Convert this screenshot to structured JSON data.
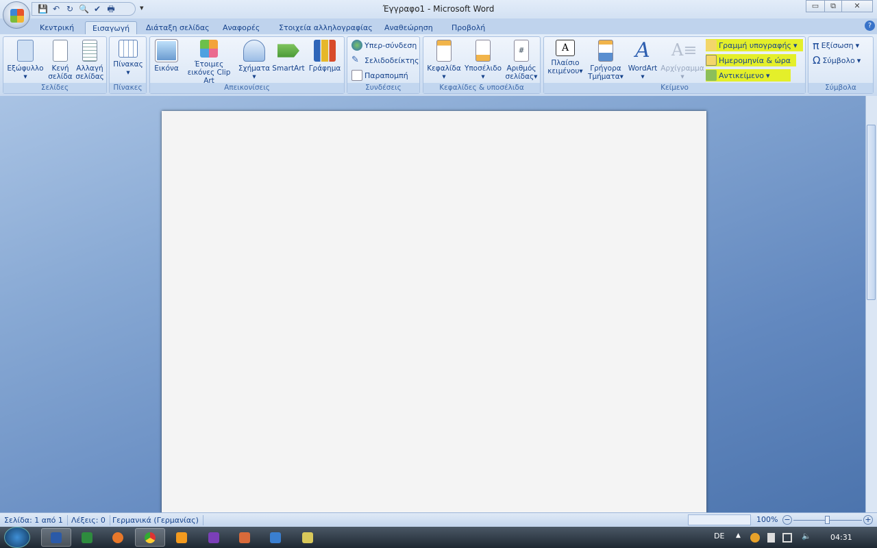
{
  "window": {
    "title": "Έγγραφο1 - Microsoft Word",
    "minimize": "▭",
    "restore": "⧉",
    "close": "✕"
  },
  "qat": {
    "icons": [
      "save-icon",
      "undo-icon",
      "redo-icon",
      "print-preview-icon",
      "spelling-icon",
      "quick-print-icon"
    ],
    "customize": "▾"
  },
  "tabs": [
    "Κεντρική",
    "Εισαγωγή",
    "Διάταξη σελίδας",
    "Αναφορές",
    "Στοιχεία αλληλογραφίας",
    "Αναθεώρηση",
    "Προβολή"
  ],
  "active_tab": "Εισαγωγή",
  "help": "?",
  "highlight_color": "#e4ef2a",
  "ribbon": {
    "pages": {
      "label": "Σελίδες",
      "cover": "Εξώφυλλο",
      "blank_1": "Κενή",
      "blank_2": "σελίδα",
      "break_1": "Αλλαγή",
      "break_2": "σελίδας"
    },
    "tables": {
      "label": "Πίνακες",
      "table": "Πίνακας"
    },
    "illustrations": {
      "label": "Απεικονίσεις",
      "picture": "Εικόνα",
      "clipart_1": "Έτοιμες",
      "clipart_2": "εικόνες Clip Art",
      "shapes": "Σχήματα",
      "smartart": "SmartArt",
      "chart": "Γράφημα"
    },
    "links": {
      "label": "Συνδέσεις",
      "hyperlink": "Υπερ-σύνδεση",
      "bookmark": "Σελιδοδείκτης",
      "crossref": "Παραπομπή"
    },
    "headerfooter": {
      "label": "Κεφαλίδες & υποσέλιδα",
      "header": "Κεφαλίδα",
      "footer": "Υποσέλιδο",
      "pagenum_1": "Αριθμός",
      "pagenum_2": "σελίδας"
    },
    "text": {
      "label": "Κείμενο",
      "textbox_1": "Πλαίσιο",
      "textbox_2": "κειμένου",
      "quickparts_1": "Γρήγορα",
      "quickparts_2": "Τμήματα",
      "wordart": "WordArt",
      "dropcap": "Αρχίγραμμα",
      "signature": "Γραμμή υπογραφής",
      "datetime": "Ημερομηνία & ώρα",
      "object": "Αντικείμενο"
    },
    "symbols": {
      "label": "Σύμβολα",
      "equation": "Εξίσωση",
      "symbol": "Σύμβολο",
      "pi": "π",
      "omega": "Ω"
    }
  },
  "status": {
    "page": "Σελίδα: 1 από 1",
    "words": "Λέξεις: 0",
    "language": "Γερμανικά (Γερμανίας)",
    "zoom": "100%"
  },
  "taskbar": {
    "lang": "DE",
    "time": "04:31",
    "apps": [
      "word",
      "excel",
      "firefox",
      "chrome",
      "media-player",
      "app-purple",
      "app-orange",
      "app-blue",
      "app-yellow"
    ]
  }
}
